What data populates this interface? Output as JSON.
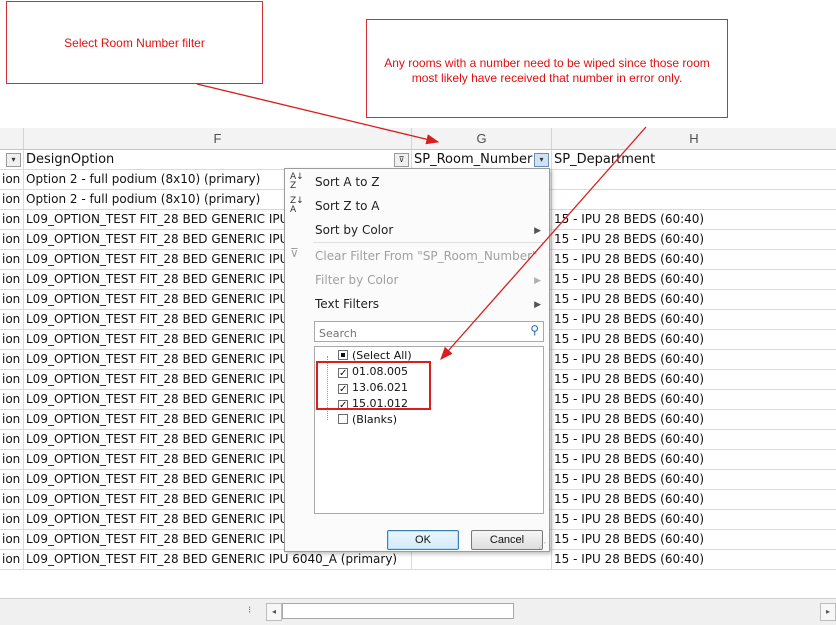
{
  "annotations": {
    "left_note": "Select Room Number filter",
    "right_note": "Any rooms with a number need to be wiped since those room most likely have received that number in error only."
  },
  "columns": {
    "f": "F",
    "g": "G",
    "h": "H"
  },
  "header_row": {
    "e": "",
    "f": "DesignOption",
    "g": "SP_Room_Number",
    "h": "SP_Department"
  },
  "rows": [
    {
      "e": "ion",
      "f": "Option 2 - full podium (8x10) (primary)",
      "h": ""
    },
    {
      "e": "ion",
      "f": "Option 2 - full podium (8x10) (primary)",
      "h": ""
    },
    {
      "e": "ion",
      "f": "L09_OPTION_TEST FIT_28 BED GENERIC IPU",
      "h": "15 - IPU 28 BEDS (60:40)"
    },
    {
      "e": "ion",
      "f": "L09_OPTION_TEST FIT_28 BED GENERIC IPU",
      "h": "15 - IPU 28 BEDS (60:40)"
    },
    {
      "e": "ion",
      "f": "L09_OPTION_TEST FIT_28 BED GENERIC IPU",
      "h": "15 - IPU 28 BEDS (60:40)"
    },
    {
      "e": "ion",
      "f": "L09_OPTION_TEST FIT_28 BED GENERIC IPU",
      "h": "15 - IPU 28 BEDS (60:40)"
    },
    {
      "e": "ion",
      "f": "L09_OPTION_TEST FIT_28 BED GENERIC IPU",
      "h": "15 - IPU 28 BEDS (60:40)"
    },
    {
      "e": "ion",
      "f": "L09_OPTION_TEST FIT_28 BED GENERIC IPU",
      "h": "15 - IPU 28 BEDS (60:40)"
    },
    {
      "e": "ion",
      "f": "L09_OPTION_TEST FIT_28 BED GENERIC IPU",
      "h": "15 - IPU 28 BEDS (60:40)"
    },
    {
      "e": "ion",
      "f": "L09_OPTION_TEST FIT_28 BED GENERIC IPU",
      "h": "15 - IPU 28 BEDS (60:40)"
    },
    {
      "e": "ion",
      "f": "L09_OPTION_TEST FIT_28 BED GENERIC IPU",
      "h": "15 - IPU 28 BEDS (60:40)"
    },
    {
      "e": "ion",
      "f": "L09_OPTION_TEST FIT_28 BED GENERIC IPU",
      "h": "15 - IPU 28 BEDS (60:40)"
    },
    {
      "e": "ion",
      "f": "L09_OPTION_TEST FIT_28 BED GENERIC IPU",
      "h": "15 - IPU 28 BEDS (60:40)"
    },
    {
      "e": "ion",
      "f": "L09_OPTION_TEST FIT_28 BED GENERIC IPU",
      "h": "15 - IPU 28 BEDS (60:40)"
    },
    {
      "e": "ion",
      "f": "L09_OPTION_TEST FIT_28 BED GENERIC IPU",
      "h": "15 - IPU 28 BEDS (60:40)"
    },
    {
      "e": "ion",
      "f": "L09_OPTION_TEST FIT_28 BED GENERIC IPU",
      "h": "15 - IPU 28 BEDS (60:40)"
    },
    {
      "e": "ion",
      "f": "L09_OPTION_TEST FIT_28 BED GENERIC IPU",
      "h": "15 - IPU 28 BEDS (60:40)"
    },
    {
      "e": "ion",
      "f": "L09_OPTION_TEST FIT_28 BED GENERIC IPU",
      "h": "15 - IPU 28 BEDS (60:40)"
    },
    {
      "e": "ion",
      "f": "L09_OPTION_TEST FIT_28 BED GENERIC IPU",
      "h": "15 - IPU 28 BEDS (60:40)"
    },
    {
      "e": "ion",
      "f": "L09_OPTION_TEST FIT_28 BED GENERIC IPU 6040_A (primary)",
      "h": "15 - IPU 28 BEDS (60:40)"
    }
  ],
  "filter_menu": {
    "sort_az": "Sort A to Z",
    "sort_za": "Sort Z to A",
    "sort_by_color": "Sort by Color",
    "clear_filter": "Clear Filter From \"SP_Room_Number\"",
    "filter_by_color": "Filter by Color",
    "text_filters": "Text Filters",
    "search_placeholder": "Search",
    "list_items": [
      {
        "label": "(Select All)",
        "state": "partial"
      },
      {
        "label": "01.08.005",
        "state": "checked"
      },
      {
        "label": "13.06.021",
        "state": "checked"
      },
      {
        "label": "15.01.012",
        "state": "checked"
      },
      {
        "label": "(Blanks)",
        "state": "unchecked"
      }
    ],
    "ok_label": "OK",
    "cancel_label": "Cancel"
  },
  "colors": {
    "annotation_red": "#e01010",
    "highlight_red": "#d81e1e"
  }
}
